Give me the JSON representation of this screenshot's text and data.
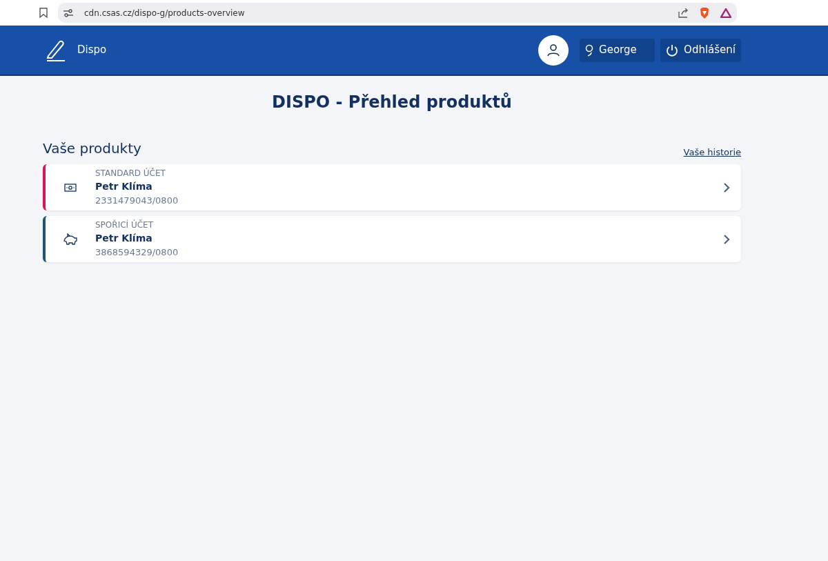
{
  "browser": {
    "url": "cdn.csas.cz/dispo-g/products-overview"
  },
  "header": {
    "app_name": "Dispo",
    "user_button": "George",
    "logout_button": "Odhlášení"
  },
  "page_title": "DISPO - Přehled produktů",
  "section": {
    "title": "Vaše produkty",
    "history_link": "Vaše historie"
  },
  "products": [
    {
      "kind": "current",
      "color": "#d8145c",
      "type": "STANDARD ÚČET",
      "owner": "Petr Klíma",
      "account": "2331479043/0800"
    },
    {
      "kind": "savings",
      "color": "#1f5674",
      "type": "SPOŘICÍ ÚČET",
      "owner": "Petr Klíma",
      "account": "3868594329/0800"
    }
  ]
}
